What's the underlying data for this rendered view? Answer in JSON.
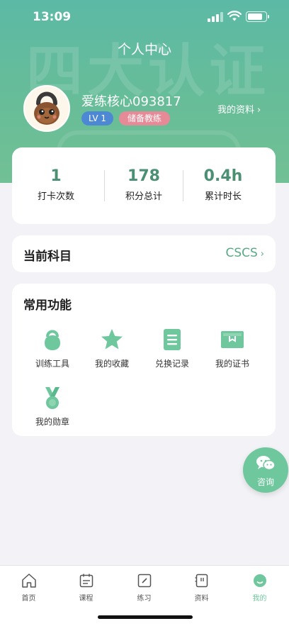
{
  "status_bar": {
    "time": "13:09"
  },
  "header": {
    "title": "个人中心",
    "watermark": "四大认证"
  },
  "profile": {
    "username": "爱练核心093817",
    "level": "LV 1",
    "role": "储备教练",
    "link_label": "我的资料",
    "chevron": "›"
  },
  "stats": [
    {
      "value": "1",
      "label": "打卡次数"
    },
    {
      "value": "178",
      "label": "积分总计"
    },
    {
      "value": "0.4h",
      "label": "累计时长"
    }
  ],
  "subject": {
    "label": "当前科目",
    "value": "CSCS",
    "chevron": "›"
  },
  "functions": {
    "title": "常用功能",
    "items": [
      {
        "label": "训练工具",
        "icon": "kettlebell-icon"
      },
      {
        "label": "我的收藏",
        "icon": "star-icon"
      },
      {
        "label": "兑换记录",
        "icon": "list-icon"
      },
      {
        "label": "我的证书",
        "icon": "certificate-icon"
      },
      {
        "label": "我的勋章",
        "icon": "medal-icon"
      }
    ]
  },
  "consult": {
    "label": "咨询",
    "icon": "wechat-icon"
  },
  "tabbar": {
    "items": [
      {
        "label": "首页",
        "icon": "home-icon"
      },
      {
        "label": "课程",
        "icon": "course-icon"
      },
      {
        "label": "练习",
        "icon": "practice-icon"
      },
      {
        "label": "资料",
        "icon": "materials-icon"
      },
      {
        "label": "我的",
        "icon": "profile-icon"
      }
    ],
    "active": "我的"
  },
  "colors": {
    "brand_green": "#6fc79e",
    "stat_value": "#4b8f74",
    "header_top": "#5cb9a5",
    "header_bottom": "#72c095",
    "level_badge": "#4d88d4",
    "role_badge": "#e68a98"
  }
}
